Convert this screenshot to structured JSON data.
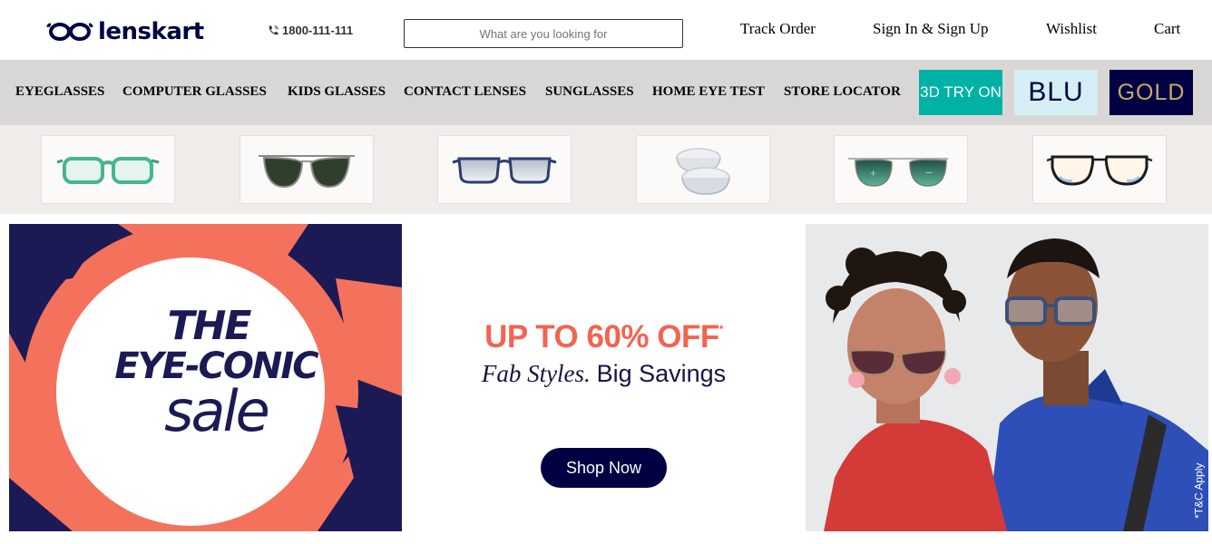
{
  "header": {
    "brand": "lenskart",
    "phone": "1800-111-111",
    "search_placeholder": "What are you looking for",
    "links": {
      "track_order": "Track Order",
      "sign_in": "Sign In & Sign Up",
      "wishlist": "Wishlist",
      "cart": "Cart"
    }
  },
  "nav": {
    "items": [
      "EYEGLASSES",
      "COMPUTER GLASSES",
      "KIDS GLASSES",
      "CONTACT LENSES",
      "SUNGLASSES",
      "HOME EYE TEST",
      "STORE LOCATOR"
    ],
    "try_on": "3D TRY ON",
    "blu": "BLU",
    "gold": "GOLD"
  },
  "categories": [
    {
      "icon": "green-eyeglasses-icon"
    },
    {
      "icon": "aviator-sunglasses-icon"
    },
    {
      "icon": "blue-eyeglasses-icon"
    },
    {
      "icon": "contact-lens-icon"
    },
    {
      "icon": "green-lens-sunglasses-icon"
    },
    {
      "icon": "clear-aviator-glasses-icon"
    }
  ],
  "banner": {
    "line1": "THE",
    "line2": "EYE-CONIC",
    "line3": "sale",
    "offer": "UP TO 60% OFF",
    "offer_mark": "*",
    "tagline_italic": "Fab Styles.",
    "tagline_regular": "Big Savings",
    "cta": "Shop Now",
    "tnc": "*T&C Apply"
  },
  "colors": {
    "navy": "#000042",
    "coral": "#f26452",
    "teal": "#00b2a6"
  }
}
